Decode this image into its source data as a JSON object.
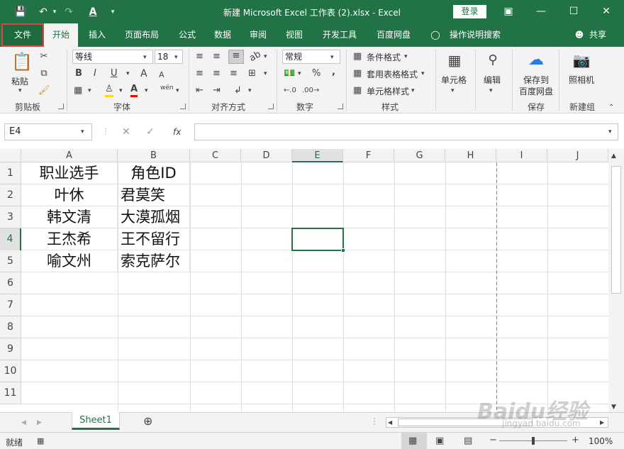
{
  "titlebar": {
    "title": "新建 Microsoft Excel 工作表 (2).xlsx  -  Excel",
    "login": "登录"
  },
  "tabs": [
    "文件",
    "开始",
    "插入",
    "页面布局",
    "公式",
    "数据",
    "审阅",
    "视图",
    "开发工具",
    "百度网盘",
    "操作说明搜索",
    "共享"
  ],
  "ribbon": {
    "clipboard": {
      "paste": "粘贴",
      "label": "剪贴板"
    },
    "font": {
      "name": "等线",
      "size": "18",
      "bold": "B",
      "italic": "I",
      "underline": "U",
      "grow": "A",
      "shrink": "A",
      "label": "字体",
      "wen": "wén"
    },
    "align": {
      "label": "对齐方式"
    },
    "number": {
      "format": "常规",
      "percent": "%",
      "comma": ",",
      "label": "数字"
    },
    "styles": {
      "conditional": "条件格式",
      "table": "套用表格格式",
      "cell": "单元格样式",
      "label": "样式"
    },
    "cells": {
      "label": "单元格"
    },
    "editing": {
      "label": "编辑"
    },
    "save": {
      "label1": "保存到",
      "label2": "百度网盘",
      "group": "保存"
    },
    "camera": {
      "label": "照相机",
      "group": "新建组"
    }
  },
  "formula": {
    "namebox": "E4",
    "fx": "fx",
    "value": ""
  },
  "columns": [
    "A",
    "B",
    "C",
    "D",
    "E",
    "F",
    "G",
    "H",
    "I",
    "J"
  ],
  "rows": [
    "1",
    "2",
    "3",
    "4",
    "5",
    "6",
    "7",
    "8",
    "9",
    "10",
    "11"
  ],
  "cells": {
    "A1": "职业选手",
    "B1": "角色ID",
    "A2": "叶休",
    "B2": "君莫笑",
    "A3": "韩文清",
    "B3": "大漠孤烟",
    "A4": "王杰希",
    "B4": "王不留行",
    "A5": "喻文州",
    "B5": "索克萨尔"
  },
  "sheets": [
    "Sheet1"
  ],
  "status": {
    "ready": "就绪",
    "zoom": "100%"
  },
  "watermark": {
    "brand": "Baidu经验",
    "url": "jingyan.baidu.com"
  },
  "colors": {
    "accent": "#217346"
  }
}
